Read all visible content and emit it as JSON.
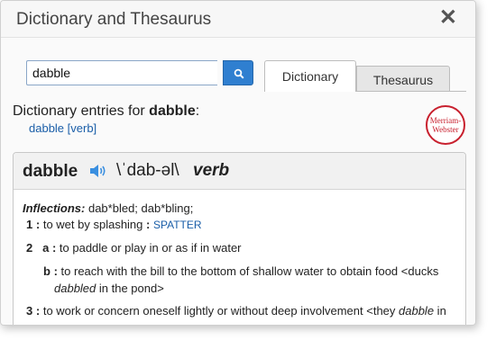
{
  "window": {
    "title": "Dictionary and Thesaurus",
    "close_glyph": "✕"
  },
  "search": {
    "value": "dabble",
    "button_icon": "search-icon"
  },
  "tabs": [
    {
      "label": "Dictionary",
      "active": true
    },
    {
      "label": "Thesaurus",
      "active": false
    }
  ],
  "results": {
    "entries_for_prefix": "Dictionary entries for",
    "query_word": "dabble",
    "query_suffix": ":",
    "entry_link": "dabble [verb]"
  },
  "logo": {
    "line1": "Merriam-",
    "line2": "Webster",
    "mark": "®"
  },
  "entry": {
    "headword": "dabble",
    "pronunciation": "\\ˈdab-əl\\",
    "part_of_speech": "verb",
    "speaker_icon": "speaker-icon",
    "inflections_label": "Inflections:",
    "inflections_text": "dab*bled; dab*bling;",
    "senses": [
      {
        "num": "1",
        "sep": ":",
        "text": "to wet by splashing",
        "sep2": ":",
        "keyword": "SPATTER"
      },
      {
        "num": "2",
        "sub": "a",
        "sep": ":",
        "text": "to paddle or play in or as if in water"
      },
      {
        "sub": "b",
        "sep": ":",
        "text": "to reach with the bill to the bottom of shallow water to obtain food <ducks",
        "cont_italic": "dabbled",
        "cont": " in the pond>"
      },
      {
        "num": "3",
        "sep": ":",
        "text": "to work or concern oneself lightly or without deep involvement <they ",
        "italic": "dabble",
        "tail": " in"
      }
    ]
  },
  "colors": {
    "accent": "#2f7fd0",
    "link": "#1a5ea8",
    "logo_red": "#c8202e"
  }
}
